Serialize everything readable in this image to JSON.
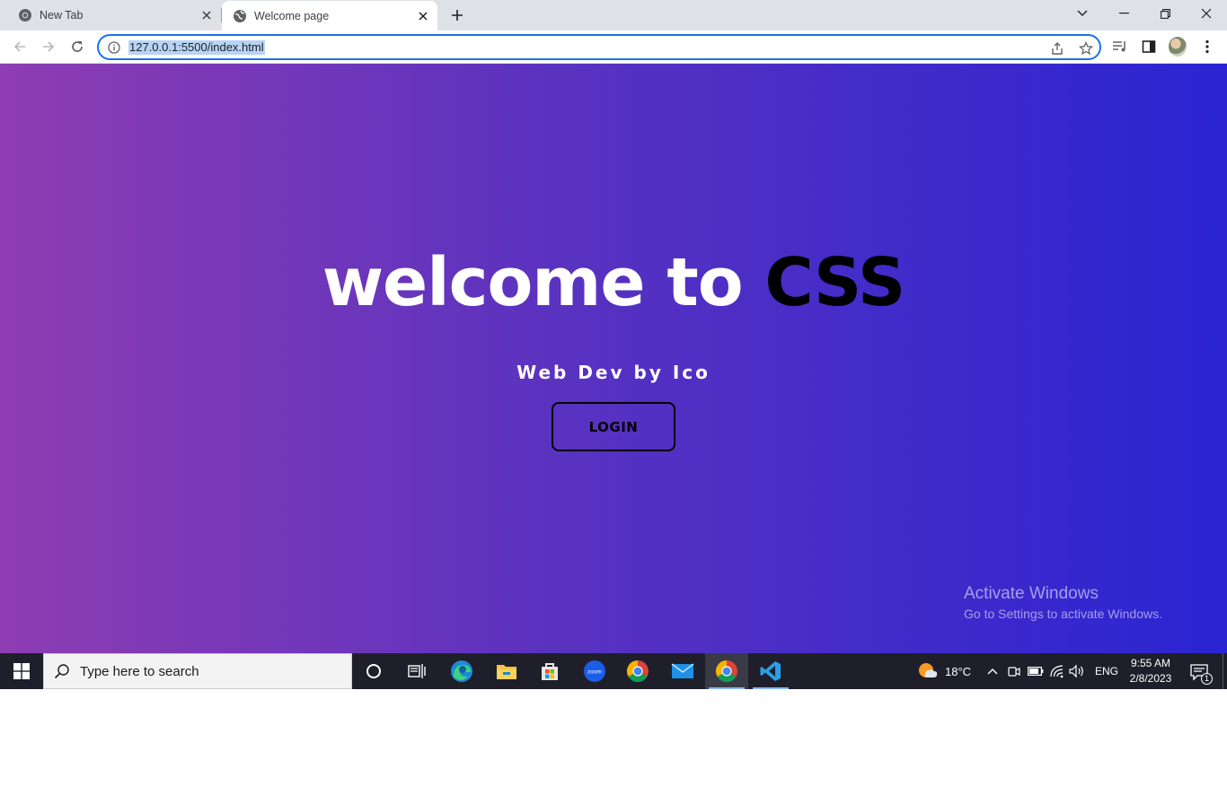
{
  "browser": {
    "tabs": [
      {
        "title": "New Tab",
        "active": false
      },
      {
        "title": "Welcome page",
        "active": true
      }
    ],
    "url": "127.0.0.1:5500/index.html"
  },
  "page": {
    "title_main": "welcome to ",
    "title_accent": "CSS",
    "subtitle": "Web Dev by Ico",
    "login_label": "LOGIN",
    "gradient": [
      "#8e3db2",
      "#2a24d2"
    ]
  },
  "watermark": {
    "line1": "Activate Windows",
    "line2": "Go to Settings to activate Windows."
  },
  "taskbar": {
    "search_placeholder": "Type here to search",
    "weather": "18°C",
    "language": "ENG",
    "time": "9:55 AM",
    "date": "2/8/2023",
    "notification_count": "1",
    "pinned": [
      "cortana-icon",
      "task-view-icon",
      "edge-icon",
      "file-explorer-icon",
      "store-icon",
      "zoom-icon",
      "chrome-icon",
      "mail-icon",
      "chrome-active-icon",
      "vscode-icon"
    ]
  }
}
